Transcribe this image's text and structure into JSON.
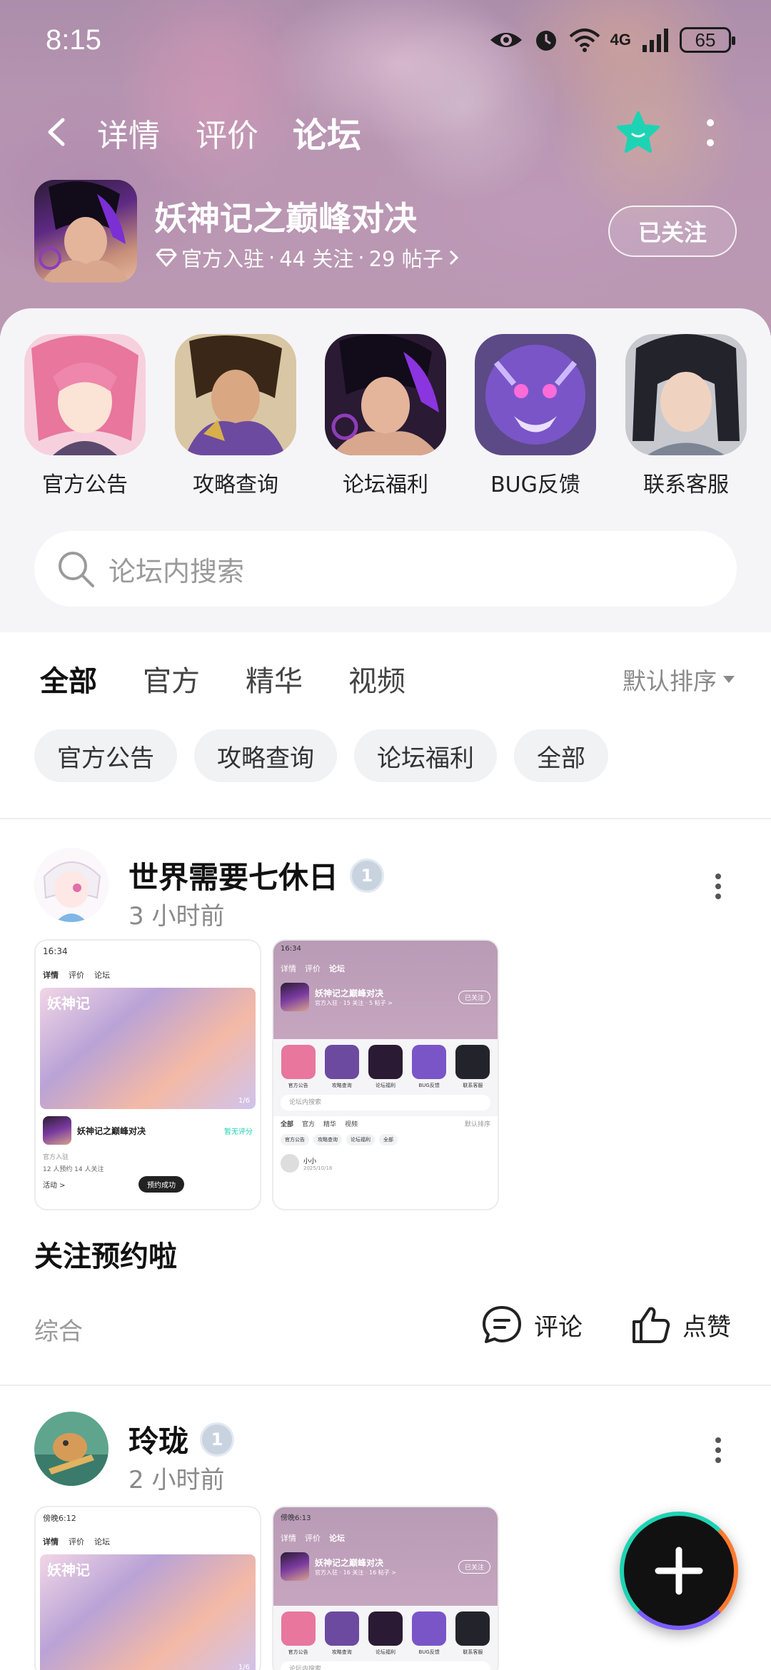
{
  "status_bar": {
    "time": "8:15",
    "network": "4G",
    "battery": "65",
    "icons": [
      "eye-icon",
      "alarm-icon",
      "wifi-icon",
      "signal-icon",
      "battery-icon"
    ]
  },
  "nav": {
    "tabs": [
      {
        "label": "详情"
      },
      {
        "label": "评价"
      },
      {
        "label": "论坛"
      }
    ],
    "active_tab": "论坛",
    "accent_color": "#1ed3b3"
  },
  "game": {
    "title": "妖神记之巅峰对决",
    "official": "官方入驻",
    "followers": "44 关注",
    "posts": "29 帖子",
    "follow_button": "已关注"
  },
  "quick_links": [
    {
      "label": "官方公告"
    },
    {
      "label": "攻略查询"
    },
    {
      "label": "论坛福利"
    },
    {
      "label": "BUG反馈"
    },
    {
      "label": "联系客服"
    }
  ],
  "search": {
    "placeholder": "论坛内搜索"
  },
  "filter_tabs": [
    {
      "label": "全部"
    },
    {
      "label": "官方"
    },
    {
      "label": "精华"
    },
    {
      "label": "视频"
    }
  ],
  "sort_label": "默认排序",
  "chips": [
    {
      "label": "官方公告"
    },
    {
      "label": "攻略查询"
    },
    {
      "label": "论坛福利"
    },
    {
      "label": "全部"
    }
  ],
  "posts": [
    {
      "author": "世界需要七休日",
      "level": "1",
      "time": "3 小时前",
      "text": "关注预约啦",
      "category": "综合",
      "comment_label": "评论",
      "like_label": "点赞",
      "shot_left": {
        "time": "16:34",
        "tabs": [
          "详情",
          "评价",
          "论坛"
        ],
        "banner_text": "妖神记",
        "page": "1/6",
        "game_title": "妖神记之巅峰对决",
        "rating": "暂无评分",
        "official": "官方入驻",
        "stats": "12 人预约  14 人关注",
        "activity": "活动 >",
        "toast": "预约成功"
      },
      "shot_right": {
        "time": "16:34",
        "tabs": [
          "详情",
          "评价",
          "论坛"
        ],
        "game_title": "妖神记之巅峰对决",
        "meta": "官方入驻 · 15 关注 · 5 帖子 >",
        "follow": "已关注",
        "quick": [
          "官方公告",
          "攻略查询",
          "论坛福利",
          "BUG反馈",
          "联系客服"
        ],
        "search": "论坛内搜索",
        "filters": [
          "全部",
          "官方",
          "精华",
          "视频"
        ],
        "sort": "默认排序",
        "chips": [
          "官方公告",
          "攻略查询",
          "论坛福利",
          "全部"
        ],
        "post_author": "小小",
        "post_time": "2025/10/18"
      }
    },
    {
      "author": "玲珑",
      "level": "1",
      "time": "2 小时前",
      "shot_left": {
        "time": "傍晚6:12",
        "tabs": [
          "详情",
          "评价",
          "论坛"
        ],
        "banner_text": "妖神记",
        "page": "1/6"
      },
      "shot_right": {
        "time": "傍晚6:13",
        "tabs": [
          "详情",
          "评价",
          "论坛"
        ],
        "game_title": "妖神记之巅峰对决",
        "meta": "官方入驻 · 16 关注 · 16 帖子 >",
        "follow": "已关注",
        "quick": [
          "官方公告",
          "攻略查询",
          "论坛福利",
          "BUG反馈",
          "联系客服"
        ],
        "search": "论坛内搜索"
      }
    }
  ]
}
